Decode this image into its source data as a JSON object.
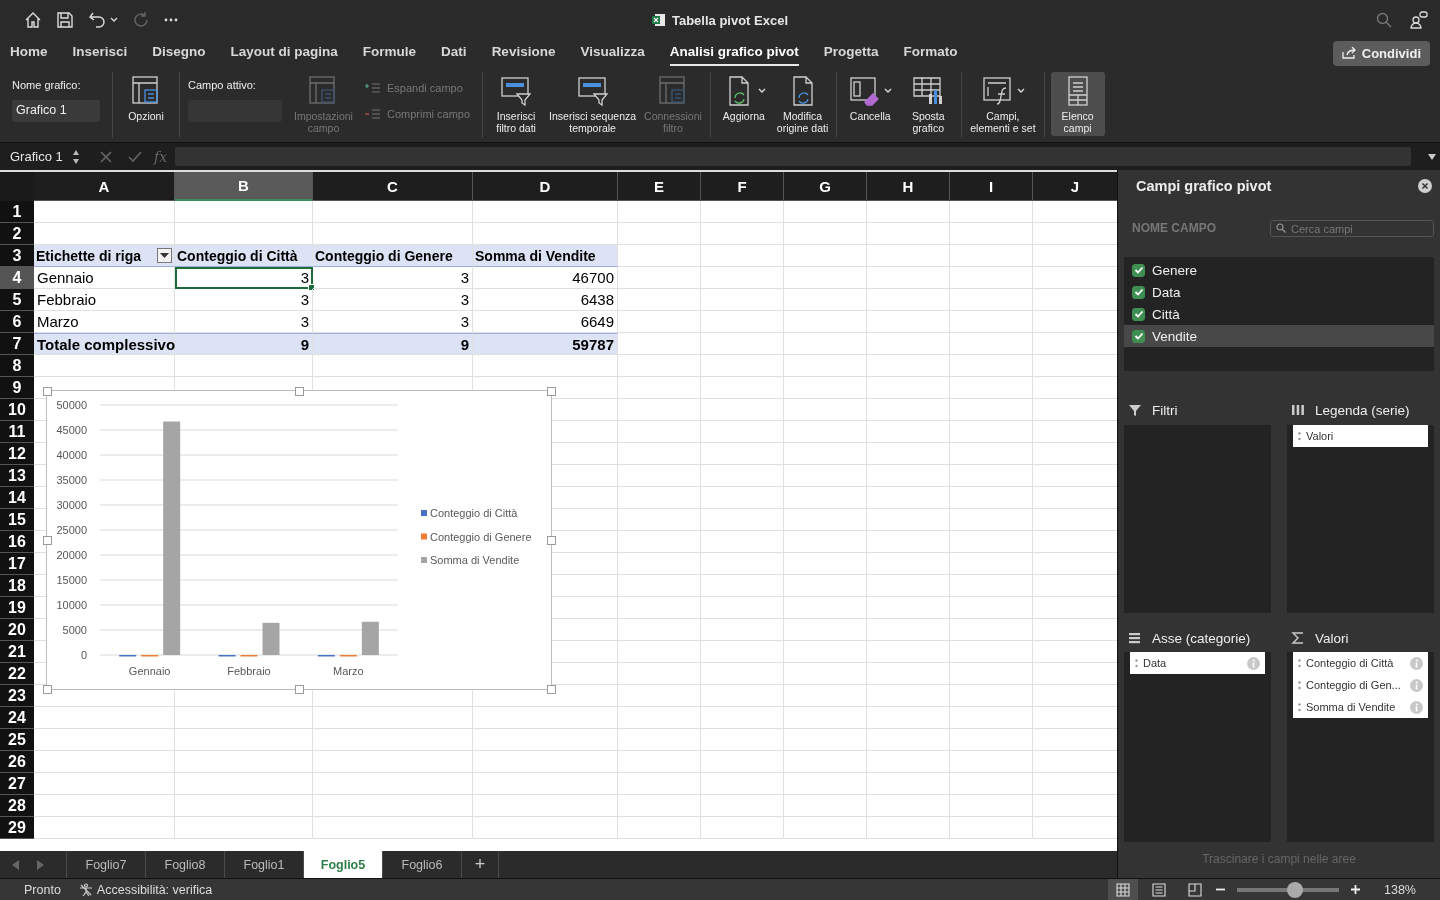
{
  "window": {
    "title": "Tabella pivot Excel"
  },
  "share_button": {
    "label": "Condividi"
  },
  "ribbon_tabs": [
    {
      "label": "Home",
      "selected": false
    },
    {
      "label": "Inserisci",
      "selected": false
    },
    {
      "label": "Disegno",
      "selected": false
    },
    {
      "label": "Layout di pagina",
      "selected": false
    },
    {
      "label": "Formule",
      "selected": false
    },
    {
      "label": "Dati",
      "selected": false
    },
    {
      "label": "Revisione",
      "selected": false
    },
    {
      "label": "Visualizza",
      "selected": false
    },
    {
      "label": "Analisi grafico pivot",
      "selected": true
    },
    {
      "label": "Progetta",
      "selected": false
    },
    {
      "label": "Formato",
      "selected": false
    }
  ],
  "ribbon": {
    "groups": [
      {
        "items": [
          {
            "kind": "field",
            "label": "Nome grafico:",
            "value": "Grafico 1",
            "disabled": false
          }
        ]
      },
      {
        "items": [
          {
            "kind": "large",
            "label": "Opzioni",
            "disabled": false,
            "dropdown": false,
            "on": false
          }
        ]
      },
      {
        "items": [
          {
            "kind": "field",
            "label": "Campo attivo:",
            "disabled": true
          },
          {
            "kind": "large",
            "label": "Impostazioni\ncampo",
            "disabled": true,
            "dropdown": false,
            "on": false
          },
          {
            "kind": "stack",
            "items": [
              {
                "label": "Espandi campo",
                "disabled": true
              },
              {
                "label": "Comprimi campo",
                "disabled": true
              }
            ]
          }
        ]
      },
      {
        "items": [
          {
            "kind": "large",
            "label": "Inserisci\nfiltro dati",
            "disabled": false,
            "dropdown": false,
            "on": false
          },
          {
            "kind": "large",
            "label": "Inserisci sequenza\ntemporale",
            "disabled": false,
            "dropdown": false,
            "on": false
          },
          {
            "kind": "large",
            "label": "Connessioni\nfiltro",
            "disabled": true,
            "dropdown": false,
            "on": false
          }
        ]
      },
      {
        "items": [
          {
            "kind": "large",
            "label": "Aggiorna",
            "disabled": false,
            "dropdown": true,
            "on": false
          },
          {
            "kind": "large",
            "label": "Modifica\norigine dati",
            "disabled": false,
            "dropdown": false,
            "on": false
          }
        ]
      },
      {
        "items": [
          {
            "kind": "large",
            "label": "Cancella",
            "disabled": false,
            "dropdown": true,
            "on": false
          },
          {
            "kind": "large",
            "label": "Sposta\ngrafico",
            "disabled": false,
            "dropdown": false,
            "on": false
          }
        ]
      },
      {
        "items": [
          {
            "kind": "large",
            "label": "Campi,\nelementi e set",
            "disabled": false,
            "dropdown": true,
            "on": false
          }
        ]
      },
      {
        "items": [
          {
            "kind": "large",
            "label": "Elenco\ncampi",
            "disabled": false,
            "dropdown": false,
            "on": true
          }
        ]
      }
    ]
  },
  "formula_bar": {
    "name_box": "Grafico 1",
    "function_label": "fx"
  },
  "sheet": {
    "columns": [
      {
        "label": "A",
        "selected": false
      },
      {
        "label": "B",
        "selected": true
      },
      {
        "label": "C",
        "selected": false
      },
      {
        "label": "D",
        "selected": false
      },
      {
        "label": "E",
        "selected": false
      },
      {
        "label": "F",
        "selected": false
      },
      {
        "label": "G",
        "selected": false
      },
      {
        "label": "H",
        "selected": false
      },
      {
        "label": "I",
        "selected": false
      },
      {
        "label": "J",
        "selected": false
      }
    ],
    "rows": [
      {
        "label": "1",
        "selected": false
      },
      {
        "label": "2",
        "selected": false
      },
      {
        "label": "3",
        "selected": false
      },
      {
        "label": "4",
        "selected": true
      },
      {
        "label": "5",
        "selected": false
      },
      {
        "label": "6",
        "selected": false
      },
      {
        "label": "7",
        "selected": false
      },
      {
        "label": "8",
        "selected": false
      },
      {
        "label": "9",
        "selected": false
      },
      {
        "label": "10",
        "selected": false
      },
      {
        "label": "11",
        "selected": false
      },
      {
        "label": "12",
        "selected": false
      },
      {
        "label": "13",
        "selected": false
      },
      {
        "label": "14",
        "selected": false
      },
      {
        "label": "15",
        "selected": false
      },
      {
        "label": "16",
        "selected": false
      },
      {
        "label": "17",
        "selected": false
      },
      {
        "label": "18",
        "selected": false
      },
      {
        "label": "19",
        "selected": false
      },
      {
        "label": "20",
        "selected": false
      },
      {
        "label": "21",
        "selected": false
      },
      {
        "label": "22",
        "selected": false
      },
      {
        "label": "23",
        "selected": false
      },
      {
        "label": "24",
        "selected": false
      },
      {
        "label": "25",
        "selected": false
      },
      {
        "label": "26",
        "selected": false
      },
      {
        "label": "27",
        "selected": false
      },
      {
        "label": "28",
        "selected": false
      },
      {
        "label": "29",
        "selected": false
      }
    ]
  },
  "pivot": {
    "header": [
      "Etichette di riga",
      "Conteggio di Città",
      "Conteggio di Genere",
      "Somma di Vendite"
    ],
    "rows": [
      [
        "Gennaio",
        "3",
        "3",
        "46700"
      ],
      [
        "Febbraio",
        "3",
        "3",
        "6438"
      ],
      [
        "Marzo",
        "3",
        "3",
        "6649"
      ]
    ],
    "total": [
      "Totale complessivo",
      "9",
      "9",
      "59787"
    ]
  },
  "chart": {
    "chart_data": {
      "type": "bar",
      "categories": [
        "Gennaio",
        "Febbraio",
        "Marzo"
      ],
      "series": [
        {
          "name": "Conteggio di Città",
          "color": "#4472c4",
          "values": [
            3,
            3,
            3
          ]
        },
        {
          "name": "Conteggio di Genere",
          "color": "#ed7d31",
          "values": [
            3,
            3,
            3
          ]
        },
        {
          "name": "Somma di Vendite",
          "color": "#a5a5a5",
          "values": [
            46700,
            6438,
            6649
          ]
        }
      ],
      "grid": true,
      "legend": true,
      "ylim": [
        0,
        50000
      ],
      "yticks": [
        0,
        5000,
        10000,
        15000,
        20000,
        25000,
        30000,
        35000,
        40000,
        45000,
        50000
      ]
    }
  },
  "sheet_tabs": [
    {
      "label": "Foglio7",
      "selected": false
    },
    {
      "label": "Foglio8",
      "selected": false
    },
    {
      "label": "Foglio1",
      "selected": false
    },
    {
      "label": "Foglio5",
      "selected": true
    },
    {
      "label": "Foglio6",
      "selected": false
    }
  ],
  "add_sheet_button": "+",
  "pivot_panel": {
    "title": "Campi grafico pivot",
    "column_heading": "NOME CAMPO",
    "search": {
      "placeholder": "Cerca campi"
    },
    "fields": [
      {
        "label": "Genere",
        "checked": true,
        "selected": false
      },
      {
        "label": "Data",
        "checked": true,
        "selected": false
      },
      {
        "label": "Città",
        "checked": true,
        "selected": false
      },
      {
        "label": "Vendite",
        "checked": true,
        "selected": true
      }
    ],
    "areas": [
      {
        "title": "Filtri"
      },
      {
        "title": "Legenda (serie)",
        "items": [
          {
            "label": "Valori",
            "info": false
          }
        ]
      },
      {
        "title": "Asse (categorie)",
        "items": [
          {
            "label": "Data",
            "info": true
          }
        ]
      },
      {
        "title": "Valori",
        "items": [
          {
            "label": "Conteggio di Città",
            "info": true
          },
          {
            "label": "Conteggio di Gen...",
            "info": true
          },
          {
            "label": "Somma di Vendite",
            "info": true
          }
        ]
      }
    ],
    "hint": "Trascinare i campi nelle aree"
  },
  "status_bar": {
    "status": "Pronto",
    "accessibility": "Accessibilità: verifica",
    "views": [
      {
        "selected": true
      },
      {
        "selected": false
      },
      {
        "selected": false
      }
    ],
    "zoom": {
      "level": 0.57,
      "reading": "138%"
    }
  }
}
